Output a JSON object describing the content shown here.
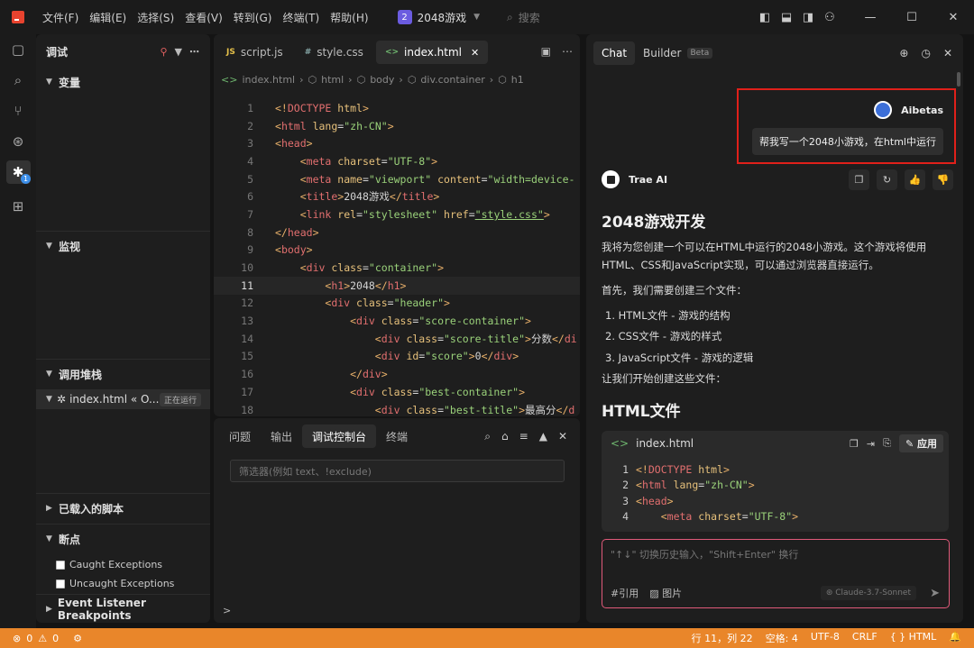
{
  "menu": [
    "文件(F)",
    "编辑(E)",
    "选择(S)",
    "查看(V)",
    "转到(G)",
    "终端(T)",
    "帮助(H)"
  ],
  "project": {
    "badge": "2",
    "name": "2048游戏"
  },
  "search": {
    "label": "搜索"
  },
  "sidebar": {
    "title": "调试",
    "sections": {
      "variables": "变量",
      "watch": "监视",
      "callstack": "调用堆栈",
      "loaded": "已载入的脚本",
      "breakpoints": "断点",
      "event": "Event Listener Breakpoints"
    },
    "stack_item": "index.html « O...",
    "running": "正在运行",
    "caught": "Caught Exceptions",
    "uncaught": "Uncaught Exceptions"
  },
  "editor": {
    "tabs": [
      {
        "icon": "JS",
        "label": "script.js"
      },
      {
        "icon": "#",
        "label": "style.css"
      },
      {
        "icon": "<>",
        "label": "index.html"
      }
    ],
    "breadcrumb": [
      "index.html",
      "html",
      "body",
      "div.container",
      "h1"
    ],
    "lines": [
      "1",
      "2",
      "3",
      "4",
      "5",
      "6",
      "7",
      "8",
      "9",
      "10",
      "11",
      "12",
      "13",
      "14",
      "15",
      "16",
      "17",
      "18"
    ]
  },
  "panel": {
    "tabs": [
      "问题",
      "输出",
      "调试控制台",
      "终端"
    ],
    "filter_placeholder": "筛选器(例如 text、!exclude)",
    "prompt": ">"
  },
  "chat": {
    "tabs": {
      "chat": "Chat",
      "builder": "Builder",
      "beta": "Beta"
    },
    "user": "Aibetas",
    "user_msg": "帮我写一个2048小游戏，在html中运行",
    "ai_name": "Trae AI",
    "h1": "2048游戏开发",
    "p1": "我将为您创建一个可以在HTML中运行的2048小游戏。这个游戏将使用HTML、CSS和JavaScript实现，可以通过浏览器直接运行。",
    "p2": "首先，我们需要创建三个文件：",
    "list": [
      "1. HTML文件 - 游戏的结构",
      "2. CSS文件 - 游戏的样式",
      "3. JavaScript文件 - 游戏的逻辑"
    ],
    "p3": "让我们开始创建这些文件：",
    "h2": "HTML文件",
    "code_file": "index.html",
    "apply": "应用",
    "code_nums": [
      "1",
      "2",
      "3",
      "4"
    ],
    "input_placeholder": "\"↑↓\" 切换历史输入，\"Shift+Enter\" 换行",
    "ref": "#引用",
    "image": "图片",
    "model": "Claude-3.7-Sonnet"
  },
  "status": {
    "errors": "0",
    "warnings": "0",
    "pos": "行 11，列 22",
    "spaces": "空格: 4",
    "enc": "UTF-8",
    "eol": "CRLF",
    "lang": "{ } HTML"
  }
}
